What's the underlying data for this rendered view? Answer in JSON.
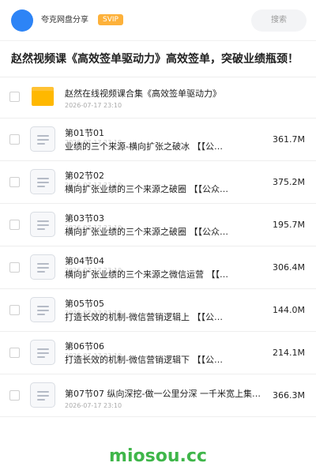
{
  "header": {
    "share_name": "夸克网盘分享",
    "badge": "SVIP",
    "search_placeholder": "搜索"
  },
  "page_title": "赵然视频课《高效签单驱动力》高效签单，突破业绩瓶颈！",
  "folder": {
    "name": "赵然在线视频课合集《高效签单驱动力》",
    "date": "2026-07-17 23:10"
  },
  "files": [
    {
      "name": "第01节01",
      "subtitle": "业绩的三个来源-横向扩张之破冰 【【公…",
      "date": "2026-07-17 23:10",
      "size": "361.7M"
    },
    {
      "name": "第02节02",
      "subtitle": "横向扩张业绩的三个来源之破圈 【【公众…",
      "date": "2026-07-17 23:10",
      "size": "375.2M"
    },
    {
      "name": "第03节03",
      "subtitle": "横向扩张业绩的三个来源之破圈 【【公众…",
      "date": "2026-07-17 23:10",
      "size": "195.7M"
    },
    {
      "name": "第04节04",
      "subtitle": "横向扩张业绩的三个来源之微信运营 【【…",
      "date": "2026-07-17 23:10",
      "size": "306.4M"
    },
    {
      "name": "第05节05",
      "subtitle": "打造长效的机制-微信营销逻辑上 【【公…",
      "date": "2026-07-17 23:10",
      "size": "144.0M"
    },
    {
      "name": "第06节06",
      "subtitle": "打造长效的机制-微信营销逻辑下 【【公…",
      "date": "2026-07-17 23:10",
      "size": "214.1M"
    },
    {
      "name": "第07节07 纵向深挖-做一公里分深 一千米宽上集…",
      "subtitle": "",
      "date": "2026-07-17 23:10",
      "size": "366.3M"
    }
  ],
  "watermark": "miosou.cc",
  "colors": {
    "avatar": "#2d84f6",
    "badge": "#fdb13a",
    "folder": "#ffb800",
    "watermark": "#3fb64a"
  }
}
